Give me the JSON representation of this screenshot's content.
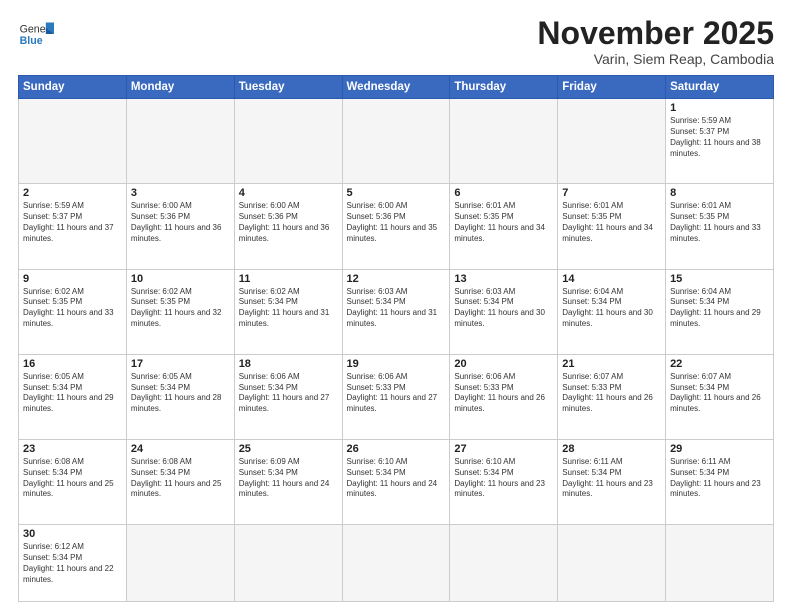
{
  "header": {
    "logo_general": "General",
    "logo_blue": "Blue",
    "month_title": "November 2025",
    "location": "Varin, Siem Reap, Cambodia"
  },
  "days_of_week": [
    "Sunday",
    "Monday",
    "Tuesday",
    "Wednesday",
    "Thursday",
    "Friday",
    "Saturday"
  ],
  "weeks": [
    [
      {
        "day": "",
        "sunrise": "",
        "sunset": "",
        "daylight": ""
      },
      {
        "day": "",
        "sunrise": "",
        "sunset": "",
        "daylight": ""
      },
      {
        "day": "",
        "sunrise": "",
        "sunset": "",
        "daylight": ""
      },
      {
        "day": "",
        "sunrise": "",
        "sunset": "",
        "daylight": ""
      },
      {
        "day": "",
        "sunrise": "",
        "sunset": "",
        "daylight": ""
      },
      {
        "day": "",
        "sunrise": "",
        "sunset": "",
        "daylight": ""
      },
      {
        "day": "1",
        "sunrise": "Sunrise: 5:59 AM",
        "sunset": "Sunset: 5:37 PM",
        "daylight": "Daylight: 11 hours and 38 minutes."
      }
    ],
    [
      {
        "day": "2",
        "sunrise": "Sunrise: 5:59 AM",
        "sunset": "Sunset: 5:37 PM",
        "daylight": "Daylight: 11 hours and 37 minutes."
      },
      {
        "day": "3",
        "sunrise": "Sunrise: 6:00 AM",
        "sunset": "Sunset: 5:36 PM",
        "daylight": "Daylight: 11 hours and 36 minutes."
      },
      {
        "day": "4",
        "sunrise": "Sunrise: 6:00 AM",
        "sunset": "Sunset: 5:36 PM",
        "daylight": "Daylight: 11 hours and 36 minutes."
      },
      {
        "day": "5",
        "sunrise": "Sunrise: 6:00 AM",
        "sunset": "Sunset: 5:36 PM",
        "daylight": "Daylight: 11 hours and 35 minutes."
      },
      {
        "day": "6",
        "sunrise": "Sunrise: 6:01 AM",
        "sunset": "Sunset: 5:35 PM",
        "daylight": "Daylight: 11 hours and 34 minutes."
      },
      {
        "day": "7",
        "sunrise": "Sunrise: 6:01 AM",
        "sunset": "Sunset: 5:35 PM",
        "daylight": "Daylight: 11 hours and 34 minutes."
      },
      {
        "day": "8",
        "sunrise": "Sunrise: 6:01 AM",
        "sunset": "Sunset: 5:35 PM",
        "daylight": "Daylight: 11 hours and 33 minutes."
      }
    ],
    [
      {
        "day": "9",
        "sunrise": "Sunrise: 6:02 AM",
        "sunset": "Sunset: 5:35 PM",
        "daylight": "Daylight: 11 hours and 33 minutes."
      },
      {
        "day": "10",
        "sunrise": "Sunrise: 6:02 AM",
        "sunset": "Sunset: 5:35 PM",
        "daylight": "Daylight: 11 hours and 32 minutes."
      },
      {
        "day": "11",
        "sunrise": "Sunrise: 6:02 AM",
        "sunset": "Sunset: 5:34 PM",
        "daylight": "Daylight: 11 hours and 31 minutes."
      },
      {
        "day": "12",
        "sunrise": "Sunrise: 6:03 AM",
        "sunset": "Sunset: 5:34 PM",
        "daylight": "Daylight: 11 hours and 31 minutes."
      },
      {
        "day": "13",
        "sunrise": "Sunrise: 6:03 AM",
        "sunset": "Sunset: 5:34 PM",
        "daylight": "Daylight: 11 hours and 30 minutes."
      },
      {
        "day": "14",
        "sunrise": "Sunrise: 6:04 AM",
        "sunset": "Sunset: 5:34 PM",
        "daylight": "Daylight: 11 hours and 30 minutes."
      },
      {
        "day": "15",
        "sunrise": "Sunrise: 6:04 AM",
        "sunset": "Sunset: 5:34 PM",
        "daylight": "Daylight: 11 hours and 29 minutes."
      }
    ],
    [
      {
        "day": "16",
        "sunrise": "Sunrise: 6:05 AM",
        "sunset": "Sunset: 5:34 PM",
        "daylight": "Daylight: 11 hours and 29 minutes."
      },
      {
        "day": "17",
        "sunrise": "Sunrise: 6:05 AM",
        "sunset": "Sunset: 5:34 PM",
        "daylight": "Daylight: 11 hours and 28 minutes."
      },
      {
        "day": "18",
        "sunrise": "Sunrise: 6:06 AM",
        "sunset": "Sunset: 5:34 PM",
        "daylight": "Daylight: 11 hours and 27 minutes."
      },
      {
        "day": "19",
        "sunrise": "Sunrise: 6:06 AM",
        "sunset": "Sunset: 5:33 PM",
        "daylight": "Daylight: 11 hours and 27 minutes."
      },
      {
        "day": "20",
        "sunrise": "Sunrise: 6:06 AM",
        "sunset": "Sunset: 5:33 PM",
        "daylight": "Daylight: 11 hours and 26 minutes."
      },
      {
        "day": "21",
        "sunrise": "Sunrise: 6:07 AM",
        "sunset": "Sunset: 5:33 PM",
        "daylight": "Daylight: 11 hours and 26 minutes."
      },
      {
        "day": "22",
        "sunrise": "Sunrise: 6:07 AM",
        "sunset": "Sunset: 5:34 PM",
        "daylight": "Daylight: 11 hours and 26 minutes."
      }
    ],
    [
      {
        "day": "23",
        "sunrise": "Sunrise: 6:08 AM",
        "sunset": "Sunset: 5:34 PM",
        "daylight": "Daylight: 11 hours and 25 minutes."
      },
      {
        "day": "24",
        "sunrise": "Sunrise: 6:08 AM",
        "sunset": "Sunset: 5:34 PM",
        "daylight": "Daylight: 11 hours and 25 minutes."
      },
      {
        "day": "25",
        "sunrise": "Sunrise: 6:09 AM",
        "sunset": "Sunset: 5:34 PM",
        "daylight": "Daylight: 11 hours and 24 minutes."
      },
      {
        "day": "26",
        "sunrise": "Sunrise: 6:10 AM",
        "sunset": "Sunset: 5:34 PM",
        "daylight": "Daylight: 11 hours and 24 minutes."
      },
      {
        "day": "27",
        "sunrise": "Sunrise: 6:10 AM",
        "sunset": "Sunset: 5:34 PM",
        "daylight": "Daylight: 11 hours and 23 minutes."
      },
      {
        "day": "28",
        "sunrise": "Sunrise: 6:11 AM",
        "sunset": "Sunset: 5:34 PM",
        "daylight": "Daylight: 11 hours and 23 minutes."
      },
      {
        "day": "29",
        "sunrise": "Sunrise: 6:11 AM",
        "sunset": "Sunset: 5:34 PM",
        "daylight": "Daylight: 11 hours and 23 minutes."
      }
    ],
    [
      {
        "day": "30",
        "sunrise": "Sunrise: 6:12 AM",
        "sunset": "Sunset: 5:34 PM",
        "daylight": "Daylight: 11 hours and 22 minutes."
      },
      {
        "day": "",
        "sunrise": "",
        "sunset": "",
        "daylight": ""
      },
      {
        "day": "",
        "sunrise": "",
        "sunset": "",
        "daylight": ""
      },
      {
        "day": "",
        "sunrise": "",
        "sunset": "",
        "daylight": ""
      },
      {
        "day": "",
        "sunrise": "",
        "sunset": "",
        "daylight": ""
      },
      {
        "day": "",
        "sunrise": "",
        "sunset": "",
        "daylight": ""
      },
      {
        "day": "",
        "sunrise": "",
        "sunset": "",
        "daylight": ""
      }
    ]
  ]
}
